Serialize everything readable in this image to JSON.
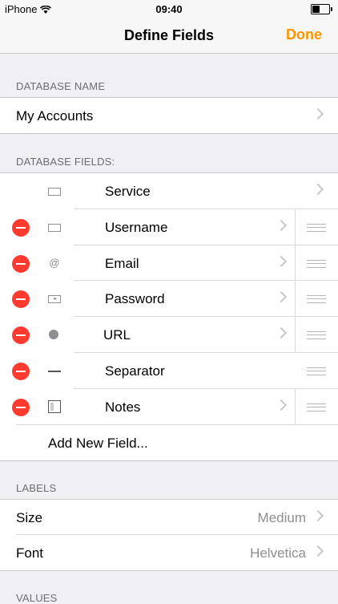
{
  "status": {
    "carrier": "iPhone",
    "time": "09:40"
  },
  "nav": {
    "title": "Define Fields",
    "done_label": "Done"
  },
  "database_name": {
    "header": "DATABASE NAME",
    "value": "My Accounts"
  },
  "database_fields": {
    "header": "DATABASE FIELDS:",
    "items": [
      {
        "name": "Service",
        "icon": "text-field-icon"
      },
      {
        "name": "Username",
        "icon": "text-field-icon"
      },
      {
        "name": "Email",
        "icon": "at-icon"
      },
      {
        "name": "Password",
        "icon": "password-field-icon"
      },
      {
        "name": "URL",
        "icon": "globe-icon"
      },
      {
        "name": "Separator",
        "icon": "separator-line-icon"
      },
      {
        "name": "Notes",
        "icon": "notes-icon"
      }
    ],
    "add_label": "Add New Field..."
  },
  "labels": {
    "header": "LABELS",
    "size_label": "Size",
    "size_value": "Medium",
    "font_label": "Font",
    "font_value": "Helvetica"
  },
  "values": {
    "header": "VALUES"
  },
  "colors": {
    "accent": "#ff9500",
    "delete": "#ff3b30",
    "background": "#efeff4"
  }
}
